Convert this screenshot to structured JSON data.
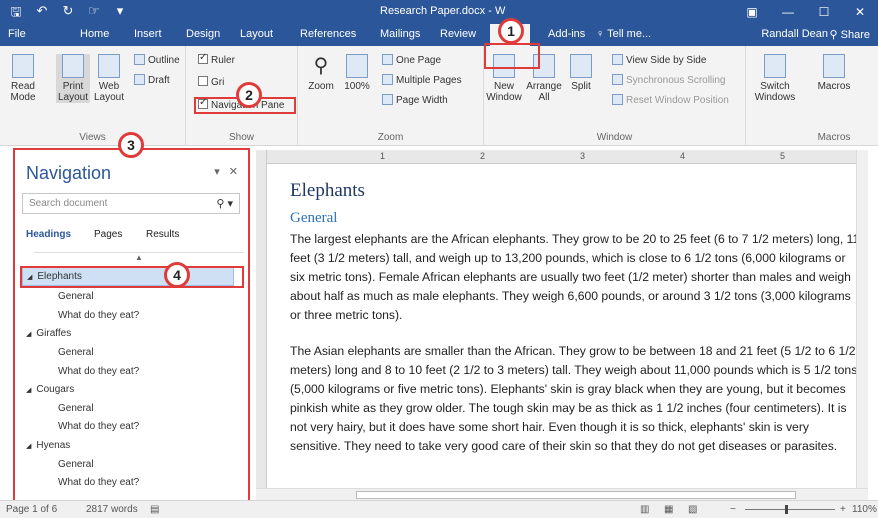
{
  "titlebar": {
    "doc_title": "Research Paper.docx - W",
    "qat": [
      "save-icon",
      "undo-icon",
      "redo-icon",
      "touch-icon",
      "more-icon"
    ]
  },
  "tabs": [
    {
      "label": "File"
    },
    {
      "label": "Home"
    },
    {
      "label": "Insert"
    },
    {
      "label": "Design"
    },
    {
      "label": "Layout"
    },
    {
      "label": "References"
    },
    {
      "label": "Mailings"
    },
    {
      "label": "Review"
    },
    {
      "label": "View"
    },
    {
      "label": "Add-ins"
    },
    {
      "label": "♀ Tell me..."
    }
  ],
  "account": {
    "user": "Randall Dean",
    "share": "Share"
  },
  "ribbon": {
    "views": {
      "label": "Views",
      "read_mode": "Read Mode",
      "print_layout": "Print Layout",
      "web_layout": "Web Layout",
      "outline": "Outline",
      "draft": "Draft"
    },
    "show": {
      "label": "Show",
      "ruler": "Ruler",
      "gridlines": "Gri",
      "navigation_pane": "Navigation Pane"
    },
    "zoom": {
      "label": "Zoom",
      "zoom": "Zoom",
      "hundred": "100%",
      "one_page": "One Page",
      "multiple_pages": "Multiple Pages",
      "page_width": "Page Width"
    },
    "window": {
      "label": "Window",
      "new_window": "New Window",
      "arrange_all": "Arrange All",
      "split": "Split",
      "side_by_side": "View Side by Side",
      "sync_scroll": "Synchronous Scrolling",
      "reset_position": "Reset Window Position",
      "switch_windows": "Switch Windows"
    },
    "macros": {
      "label": "Macros",
      "macros": "Macros"
    }
  },
  "navigation": {
    "title": "Navigation",
    "search_placeholder": "Search document",
    "tabs": [
      "Headings",
      "Pages",
      "Results"
    ],
    "headings": [
      {
        "text": "Elephants",
        "level": 1,
        "selected": true
      },
      {
        "text": "General",
        "level": 2
      },
      {
        "text": "What do they eat?",
        "level": 2
      },
      {
        "text": "Giraffes",
        "level": 1
      },
      {
        "text": "General",
        "level": 2
      },
      {
        "text": "What do they eat?",
        "level": 2
      },
      {
        "text": "Cougars",
        "level": 1
      },
      {
        "text": "General",
        "level": 2
      },
      {
        "text": "What do they eat?",
        "level": 2
      },
      {
        "text": "Hyenas",
        "level": 1
      },
      {
        "text": "General",
        "level": 2
      },
      {
        "text": "What do they eat?",
        "level": 2
      }
    ]
  },
  "callouts": [
    "1",
    "2",
    "3",
    "4"
  ],
  "ruler_numbers": [
    "1",
    "2",
    "3",
    "4",
    "5"
  ],
  "document": {
    "h1": "Elephants",
    "h2": "General",
    "p1": "The largest elephants are the African elephants. They grow to be 20 to 25 feet (6 to 7 1/2 meters) long, 11 feet (3 1/2 meters) tall, and weigh up to 13,200 pounds, which is close to 6 1/2 tons (6,000 kilograms or six metric tons). Female African elephants are usually two feet (1/2 meter) shorter than males and weigh about half as much as male elephants. They weigh 6,600 pounds, or around 3 1/2 tons (3,000 kilograms or three metric tons).",
    "p2": "The Asian elephants are smaller than the African. They grow to be between 18 and 21 feet (5 1/2 to 6 1/2 meters) long and 8 to 10 feet (2 1/2 to 3 meters) tall. They weigh about 11,000 pounds which is 5 1/2 tons (5,000 kilograms or five metric tons). Elephants' skin is gray black when they are young, but it becomes pinkish white as they grow older. The tough skin may be as thick as 1 1/2 inches (four centimeters). It is not very hairy, but it does have some short hair. Even though it is so thick, elephants' skin is very sensitive. They need to take very good care of their skin so that they do not get diseases or parasites."
  },
  "status": {
    "page": "Page 1 of 6",
    "words": "2817 words",
    "zoom": "110%"
  },
  "colors": {
    "accent": "#2b579a",
    "callout": "#e03b3b",
    "selection": "#cfe0f4"
  }
}
